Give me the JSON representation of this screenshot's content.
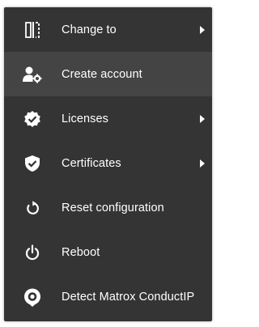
{
  "menu": {
    "items": [
      {
        "label": "Change to",
        "icon": "swap-columns-icon",
        "submenu": true
      },
      {
        "label": "Create account",
        "icon": "user-gear-icon",
        "submenu": false
      },
      {
        "label": "Licenses",
        "icon": "verified-badge-icon",
        "submenu": true
      },
      {
        "label": "Certificates",
        "icon": "shield-check-icon",
        "submenu": true
      },
      {
        "label": "Reset configuration",
        "icon": "reset-icon",
        "submenu": false
      },
      {
        "label": "Reboot",
        "icon": "power-icon",
        "submenu": false
      },
      {
        "label": "Detect Matrox ConductIP",
        "icon": "location-target-icon",
        "submenu": false
      }
    ]
  },
  "colors": {
    "menu_background": "#343434",
    "active_background": "#444444",
    "text": "#ffffff"
  }
}
